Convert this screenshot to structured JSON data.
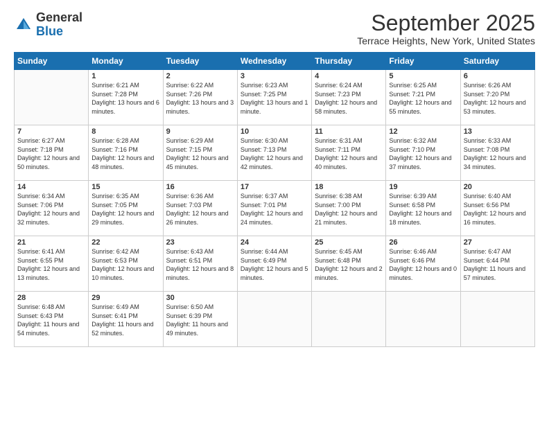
{
  "logo": {
    "general": "General",
    "blue": "Blue"
  },
  "header": {
    "month": "September 2025",
    "subtitle": "Terrace Heights, New York, United States"
  },
  "days": [
    "Sunday",
    "Monday",
    "Tuesday",
    "Wednesday",
    "Thursday",
    "Friday",
    "Saturday"
  ],
  "weeks": [
    [
      {
        "day": "",
        "sunrise": "",
        "sunset": "",
        "daylight": ""
      },
      {
        "day": "1",
        "sunrise": "Sunrise: 6:21 AM",
        "sunset": "Sunset: 7:28 PM",
        "daylight": "Daylight: 13 hours and 6 minutes."
      },
      {
        "day": "2",
        "sunrise": "Sunrise: 6:22 AM",
        "sunset": "Sunset: 7:26 PM",
        "daylight": "Daylight: 13 hours and 3 minutes."
      },
      {
        "day": "3",
        "sunrise": "Sunrise: 6:23 AM",
        "sunset": "Sunset: 7:25 PM",
        "daylight": "Daylight: 13 hours and 1 minute."
      },
      {
        "day": "4",
        "sunrise": "Sunrise: 6:24 AM",
        "sunset": "Sunset: 7:23 PM",
        "daylight": "Daylight: 12 hours and 58 minutes."
      },
      {
        "day": "5",
        "sunrise": "Sunrise: 6:25 AM",
        "sunset": "Sunset: 7:21 PM",
        "daylight": "Daylight: 12 hours and 55 minutes."
      },
      {
        "day": "6",
        "sunrise": "Sunrise: 6:26 AM",
        "sunset": "Sunset: 7:20 PM",
        "daylight": "Daylight: 12 hours and 53 minutes."
      }
    ],
    [
      {
        "day": "7",
        "sunrise": "Sunrise: 6:27 AM",
        "sunset": "Sunset: 7:18 PM",
        "daylight": "Daylight: 12 hours and 50 minutes."
      },
      {
        "day": "8",
        "sunrise": "Sunrise: 6:28 AM",
        "sunset": "Sunset: 7:16 PM",
        "daylight": "Daylight: 12 hours and 48 minutes."
      },
      {
        "day": "9",
        "sunrise": "Sunrise: 6:29 AM",
        "sunset": "Sunset: 7:15 PM",
        "daylight": "Daylight: 12 hours and 45 minutes."
      },
      {
        "day": "10",
        "sunrise": "Sunrise: 6:30 AM",
        "sunset": "Sunset: 7:13 PM",
        "daylight": "Daylight: 12 hours and 42 minutes."
      },
      {
        "day": "11",
        "sunrise": "Sunrise: 6:31 AM",
        "sunset": "Sunset: 7:11 PM",
        "daylight": "Daylight: 12 hours and 40 minutes."
      },
      {
        "day": "12",
        "sunrise": "Sunrise: 6:32 AM",
        "sunset": "Sunset: 7:10 PM",
        "daylight": "Daylight: 12 hours and 37 minutes."
      },
      {
        "day": "13",
        "sunrise": "Sunrise: 6:33 AM",
        "sunset": "Sunset: 7:08 PM",
        "daylight": "Daylight: 12 hours and 34 minutes."
      }
    ],
    [
      {
        "day": "14",
        "sunrise": "Sunrise: 6:34 AM",
        "sunset": "Sunset: 7:06 PM",
        "daylight": "Daylight: 12 hours and 32 minutes."
      },
      {
        "day": "15",
        "sunrise": "Sunrise: 6:35 AM",
        "sunset": "Sunset: 7:05 PM",
        "daylight": "Daylight: 12 hours and 29 minutes."
      },
      {
        "day": "16",
        "sunrise": "Sunrise: 6:36 AM",
        "sunset": "Sunset: 7:03 PM",
        "daylight": "Daylight: 12 hours and 26 minutes."
      },
      {
        "day": "17",
        "sunrise": "Sunrise: 6:37 AM",
        "sunset": "Sunset: 7:01 PM",
        "daylight": "Daylight: 12 hours and 24 minutes."
      },
      {
        "day": "18",
        "sunrise": "Sunrise: 6:38 AM",
        "sunset": "Sunset: 7:00 PM",
        "daylight": "Daylight: 12 hours and 21 minutes."
      },
      {
        "day": "19",
        "sunrise": "Sunrise: 6:39 AM",
        "sunset": "Sunset: 6:58 PM",
        "daylight": "Daylight: 12 hours and 18 minutes."
      },
      {
        "day": "20",
        "sunrise": "Sunrise: 6:40 AM",
        "sunset": "Sunset: 6:56 PM",
        "daylight": "Daylight: 12 hours and 16 minutes."
      }
    ],
    [
      {
        "day": "21",
        "sunrise": "Sunrise: 6:41 AM",
        "sunset": "Sunset: 6:55 PM",
        "daylight": "Daylight: 12 hours and 13 minutes."
      },
      {
        "day": "22",
        "sunrise": "Sunrise: 6:42 AM",
        "sunset": "Sunset: 6:53 PM",
        "daylight": "Daylight: 12 hours and 10 minutes."
      },
      {
        "day": "23",
        "sunrise": "Sunrise: 6:43 AM",
        "sunset": "Sunset: 6:51 PM",
        "daylight": "Daylight: 12 hours and 8 minutes."
      },
      {
        "day": "24",
        "sunrise": "Sunrise: 6:44 AM",
        "sunset": "Sunset: 6:49 PM",
        "daylight": "Daylight: 12 hours and 5 minutes."
      },
      {
        "day": "25",
        "sunrise": "Sunrise: 6:45 AM",
        "sunset": "Sunset: 6:48 PM",
        "daylight": "Daylight: 12 hours and 2 minutes."
      },
      {
        "day": "26",
        "sunrise": "Sunrise: 6:46 AM",
        "sunset": "Sunset: 6:46 PM",
        "daylight": "Daylight: 12 hours and 0 minutes."
      },
      {
        "day": "27",
        "sunrise": "Sunrise: 6:47 AM",
        "sunset": "Sunset: 6:44 PM",
        "daylight": "Daylight: 11 hours and 57 minutes."
      }
    ],
    [
      {
        "day": "28",
        "sunrise": "Sunrise: 6:48 AM",
        "sunset": "Sunset: 6:43 PM",
        "daylight": "Daylight: 11 hours and 54 minutes."
      },
      {
        "day": "29",
        "sunrise": "Sunrise: 6:49 AM",
        "sunset": "Sunset: 6:41 PM",
        "daylight": "Daylight: 11 hours and 52 minutes."
      },
      {
        "day": "30",
        "sunrise": "Sunrise: 6:50 AM",
        "sunset": "Sunset: 6:39 PM",
        "daylight": "Daylight: 11 hours and 49 minutes."
      },
      {
        "day": "",
        "sunrise": "",
        "sunset": "",
        "daylight": ""
      },
      {
        "day": "",
        "sunrise": "",
        "sunset": "",
        "daylight": ""
      },
      {
        "day": "",
        "sunrise": "",
        "sunset": "",
        "daylight": ""
      },
      {
        "day": "",
        "sunrise": "",
        "sunset": "",
        "daylight": ""
      }
    ]
  ]
}
